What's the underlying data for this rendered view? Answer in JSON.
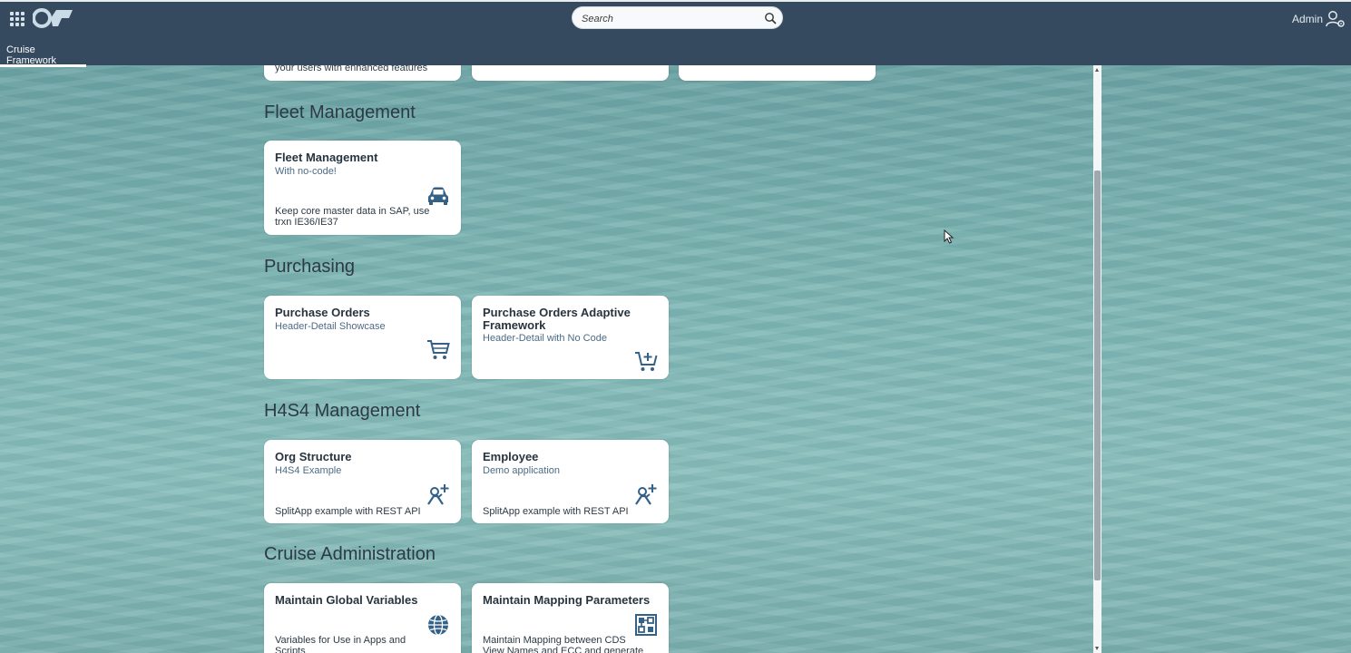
{
  "shell": {
    "search_placeholder": "Search",
    "user_name": "Admin",
    "app_tab": "Cruise Framework"
  },
  "top_row": {
    "tile1_footer": "your users with enhanced features"
  },
  "groups": {
    "fleet": {
      "title": "Fleet Management",
      "tile": {
        "title": "Fleet Management",
        "subtitle": "With no-code!",
        "footer": "Keep core master data in SAP, use trxn IE36/IE37",
        "icon": "car-icon"
      }
    },
    "purchasing": {
      "title": "Purchasing",
      "tiles": [
        {
          "title": "Purchase Orders",
          "subtitle": "Header-Detail Showcase",
          "icon": "cart-icon"
        },
        {
          "title": "Purchase Orders Adaptive Framework",
          "subtitle": "Header-Detail with No Code",
          "icon": "cart-add-icon"
        }
      ]
    },
    "h4s4": {
      "title": "H4S4 Management",
      "tiles": [
        {
          "title": "Org Structure",
          "subtitle": "H4S4 Example",
          "footer": "SplitApp example with REST API",
          "icon": "add-employee-icon"
        },
        {
          "title": "Employee",
          "subtitle": "Demo application",
          "footer": "SplitApp example with REST API",
          "icon": "add-employee-icon"
        }
      ]
    },
    "cruise_admin": {
      "title": "Cruise Administration",
      "tiles": [
        {
          "title": "Maintain Global Variables",
          "footer": "Variables for Use in Apps and Scripts",
          "icon": "globe-icon"
        },
        {
          "title": "Maintain Mapping Parameters",
          "footer": "Maintain Mapping between CDS View Names and ECC and generate class and",
          "icon": "mapping-icon"
        }
      ]
    }
  },
  "colors": {
    "shell_bg": "#354a5f",
    "tile_bg": "#ffffff",
    "icon_blue": "#346187"
  }
}
